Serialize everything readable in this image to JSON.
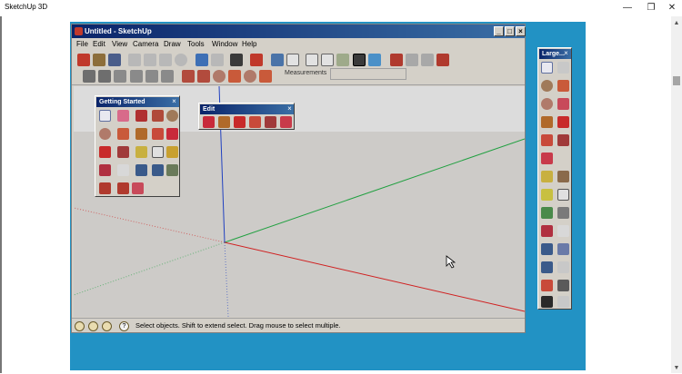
{
  "host": {
    "title": "SketchUp 3D",
    "minimize_glyph": "—",
    "maximize_glyph": "❐",
    "close_glyph": "✕",
    "scroll_up_glyph": "▲",
    "scroll_down_glyph": "▼"
  },
  "app": {
    "title": "Untitled - SketchUp",
    "minimize_glyph": "_",
    "maximize_glyph": "□",
    "close_glyph": "×",
    "menu": [
      "File",
      "Edit",
      "View",
      "Camera",
      "Draw",
      "Tools",
      "Window",
      "Help"
    ],
    "measurements_label": "Measurements",
    "measurements_value": "",
    "status_text": "Select objects. Shift to extend select. Drag mouse to select multiple.",
    "status_icons": [
      "geo-location-icon",
      "credits-icon",
      "user-icon",
      "help-icon"
    ],
    "help_glyph": "?"
  },
  "toolbars": {
    "getting_started": {
      "title": "Getting Started",
      "close_glyph": "×",
      "tools": [
        "select-icon",
        "eraser-icon",
        "line-icon",
        "rectangle-icon",
        "circle-icon",
        "arc-icon",
        "arc-2pt-icon",
        "push-pull-icon",
        "follow-me-icon",
        "move-icon",
        "rotate-icon",
        "scale-icon",
        "tape-measure-icon",
        "text-icon",
        "paint-bucket-icon",
        "orbit-icon",
        "pan-icon",
        "zoom-icon",
        "zoom-extents-icon",
        "scenes-icon",
        "3d-warehouse-icon",
        "extension-warehouse-icon",
        "send-to-layout-icon"
      ]
    },
    "edit": {
      "title": "Edit",
      "close_glyph": "×",
      "tools": [
        "move-icon",
        "push-pull-icon",
        "rotate-icon",
        "follow-me-icon",
        "scale-icon",
        "offset-icon"
      ]
    },
    "large": {
      "title": "Large...",
      "close_glyph": "×",
      "tools": [
        "select-icon",
        "make-component-icon",
        "circle-icon",
        "arc-icon",
        "polygon-icon",
        "freehand-icon",
        "push-pull-icon",
        "rotate-icon",
        "follow-me-icon",
        "scale-icon",
        "offset-icon",
        "tape-measure-icon",
        "dimension-icon",
        "protractor-icon",
        "paint-bucket-icon",
        "text-icon",
        "axes-icon",
        "3d-text-icon",
        "orbit-icon",
        "pan-icon",
        "zoom-icon",
        "zoom-window-icon",
        "zoom-extents-icon",
        "previous-view-icon",
        "position-camera-icon",
        "look-around-icon",
        "walk-icon",
        "section-plane-icon"
      ]
    }
  },
  "colors": {
    "stage_blue": "#2292c4",
    "title_gradient_start": "#0a246a",
    "title_gradient_end": "#3a6ea5",
    "chrome_gray": "#d4d0c8",
    "viewport_ground": "#cdcbc8",
    "viewport_sky": "#dcdcdc",
    "axis_red": "#d02020",
    "axis_green": "#20a040",
    "axis_blue": "#2040c0"
  }
}
